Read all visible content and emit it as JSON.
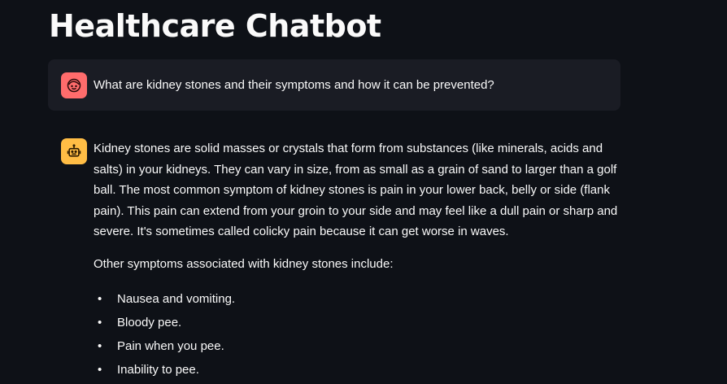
{
  "page": {
    "title": "Healthcare Chatbot"
  },
  "messages": {
    "user": {
      "avatar_icon": "face-icon",
      "avatar_color": "#ff6c6c",
      "text": "What are kidney stones and their symptoms and how it can be prevented?"
    },
    "assistant": {
      "avatar_icon": "robot-icon",
      "avatar_color": "#ffbd45",
      "paragraph1": "Kidney stones are solid masses or crystals that form from substances (like minerals, acids and salts) in your kidneys. They can vary in size, from as small as a grain of sand to larger than a golf ball. The most common symptom of kidney stones is pain in your lower back, belly or side (flank pain). This pain can extend from your groin to your side and may feel like a dull pain or sharp and severe. It's sometimes called colicky pain because it can get worse in waves.",
      "paragraph2": "Other symptoms associated with kidney stones include:",
      "bullets": [
        "Nausea and vomiting.",
        "Bloody pee.",
        "Pain when you pee.",
        "Inability to pee."
      ]
    }
  },
  "colors": {
    "background": "#0e1117",
    "user_bubble": "#1a1c24",
    "text": "#fafafa"
  }
}
